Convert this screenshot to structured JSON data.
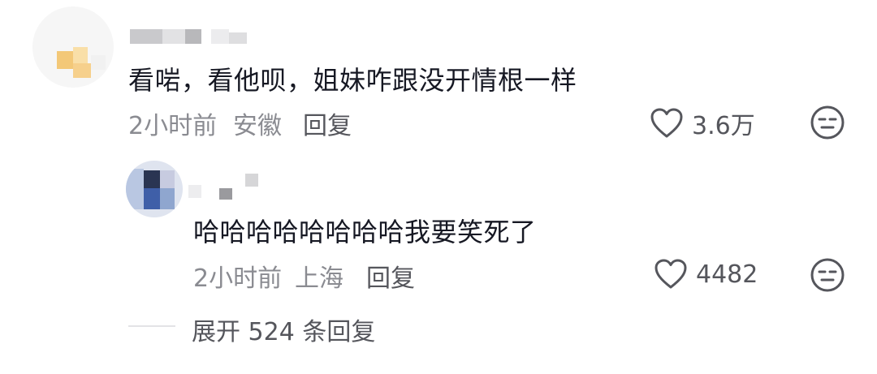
{
  "comments": [
    {
      "text": "看啱，看他呗，姐妹咋跟没开情根一样",
      "time": "2小时前",
      "location": "安徽",
      "reply_label": "回复",
      "likes": "3.6万"
    }
  ],
  "reply": {
    "text": "哈哈哈哈哈哈哈哈我要笑死了",
    "time": "2小时前",
    "location": "上海",
    "reply_label": "回复",
    "likes": "4482"
  },
  "expand": {
    "label": "展开 524 条回复"
  },
  "icons": {
    "like": "heart-outline-icon",
    "dislike": "neutral-face-icon"
  }
}
